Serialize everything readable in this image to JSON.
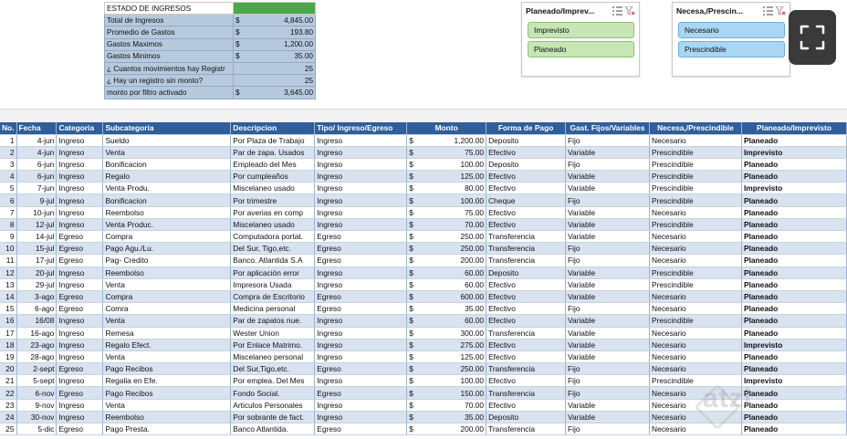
{
  "summary": {
    "title": "ESTADO DE INGRESOS",
    "rows": [
      {
        "label": "Total de Ingresos",
        "currency": "$",
        "value": "4,845.00"
      },
      {
        "label": "Promedio de Gastos",
        "currency": "$",
        "value": "193.80"
      },
      {
        "label": "Gastos Maximos",
        "currency": "$",
        "value": "1,200.00"
      },
      {
        "label": "Gastos Minimos",
        "currency": "$",
        "value": "35.00"
      },
      {
        "label": "¿ Cuantos movimientos hay Registr",
        "currency": "",
        "value": "25"
      },
      {
        "label": "¿ Hay un registro sin monto?",
        "currency": "",
        "value": "25"
      },
      {
        "label": "monto por filtro activado",
        "currency": "$",
        "value": "3,645.00"
      }
    ]
  },
  "slicer1": {
    "title": "Planeado/Imprev...",
    "options": [
      "Imprevisto",
      "Planeado"
    ]
  },
  "slicer2": {
    "title": "Necesa,/Prescin...",
    "options": [
      "Necesario",
      "Prescindible"
    ]
  },
  "table": {
    "headers": [
      "No.",
      "Fecha",
      "Categoria",
      "Subcategoria",
      "Descripcion",
      "Tipo/ Ingreso/Egreso",
      "Monto",
      "Forma de Pago",
      "Gast. Fijos/Variables",
      "Necesa,/Prescindible",
      "Planeado/Imprevisto"
    ],
    "rows": [
      [
        "1",
        "4-jun",
        "Ingreso",
        "Sueldo",
        "Por Plaza de Trabajo",
        "Ingreso",
        "$",
        "1,200.00",
        "Deposito",
        "Fijo",
        "Necesario",
        "Planeado"
      ],
      [
        "2",
        "4-jun",
        "Ingreso",
        "Venta",
        "Par de zapa. Usados",
        "Ingreso",
        "$",
        "75.00",
        "Efectivo",
        "Variable",
        "Prescindible",
        "Imprevisto"
      ],
      [
        "3",
        "6-jun",
        "Ingreso",
        "Bonificacion",
        "Empleado del Mes",
        "Ingreso",
        "$",
        "100.00",
        "Deposito",
        "Fijo",
        "Prescindible",
        "Planeado"
      ],
      [
        "4",
        "6-jun",
        "Ingreso",
        "Regalo",
        "Por cumpleaños",
        "Ingreso",
        "$",
        "125.00",
        "Efectivo",
        "Variable",
        "Prescindible",
        "Planeado"
      ],
      [
        "5",
        "7-jun",
        "Ingreso",
        "Venta Produ.",
        "Miscelaneo usado",
        "Ingreso",
        "$",
        "80.00",
        "Efectivo",
        "Variable",
        "Prescindible",
        "Imprevisto"
      ],
      [
        "6",
        "9-jul",
        "Ingreso",
        "Bonificacion",
        "Por trimestre",
        "Ingreso",
        "$",
        "100.00",
        "Cheque",
        "Fijo",
        "Prescindible",
        "Planeado"
      ],
      [
        "7",
        "10-jun",
        "Ingreso",
        "Reembolso",
        "Por averias en comp",
        "Ingreso",
        "$",
        "75.00",
        "Efectivo",
        "Variable",
        "Necesario",
        "Planeado"
      ],
      [
        "8",
        "12-jul",
        "Ingreso",
        "Venta Produc.",
        "Miscelaneo usado",
        "Ingreso",
        "$",
        "70.00",
        "Efectivo",
        "Variable",
        "Prescindible",
        "Planeado"
      ],
      [
        "9",
        "14-jul",
        "Egreso",
        "Compra",
        "Computadora portat.",
        "Egreso",
        "$",
        "250.00",
        "Transferencia",
        "Variable",
        "Necesario",
        "Planeado"
      ],
      [
        "10",
        "15-jul",
        "Egreso",
        "Pago Agu./Lu.",
        "Del Sur, Tigo,etc.",
        "Egreso",
        "$",
        "250.00",
        "Transferencia",
        "Fijo",
        "Necesario",
        "Planeado"
      ],
      [
        "11",
        "17-jul",
        "Egreso",
        "Pag- Credito",
        "Banco. Atlantida S.A",
        "Egreso",
        "$",
        "200.00",
        "Transferencia",
        "Fijo",
        "Necesario",
        "Planeado"
      ],
      [
        "12",
        "20-jul",
        "Ingreso",
        "Reembolso",
        "Por aplicación error",
        "Ingreso",
        "$",
        "60.00",
        "Deposito",
        "Variable",
        "Prescindible",
        "Planeado"
      ],
      [
        "13",
        "29-jul",
        "Ingreso",
        "Venta",
        "Impresora Usada",
        "Ingreso",
        "$",
        "60.00",
        "Efectivo",
        "Variable",
        "Prescindible",
        "Planeado"
      ],
      [
        "14",
        "3-ago",
        "Egreso",
        "Compra",
        "Compra de Escritorio",
        "Egreso",
        "$",
        "600.00",
        "Efectivo",
        "Variable",
        "Necesario",
        "Planeado"
      ],
      [
        "15",
        "6-ago",
        "Egreso",
        "Comra",
        "Medicina personal",
        "Egreso",
        "$",
        "35.00",
        "Efectivo",
        "Fijo",
        "Necesario",
        "Planeado"
      ],
      [
        "16",
        "16/08",
        "Ingreso",
        "Venta",
        "Par de zapatos nue.",
        "Ingreso",
        "$",
        "60.00",
        "Efectivo",
        "Variable",
        "Prescindible",
        "Planeado"
      ],
      [
        "17",
        "16-ago",
        "Ingreso",
        "Remesa",
        "Wester Union",
        "Ingreso",
        "$",
        "300.00",
        "Transferencia",
        "Variable",
        "Necesario",
        "Planeado"
      ],
      [
        "18",
        "23-ago",
        "Ingreso",
        "Regalo Efect.",
        "Por Enlace Matrimo.",
        "Ingreso",
        "$",
        "275.00",
        "Efectivo",
        "Variable",
        "Necesario",
        "Imprevisto"
      ],
      [
        "19",
        "28-ago",
        "Ingreso",
        "Venta",
        "Miscelaneo personal",
        "Ingreso",
        "$",
        "125.00",
        "Efectivo",
        "Variable",
        "Necesario",
        "Planeado"
      ],
      [
        "20",
        "2-sept",
        "Egreso",
        "Pago Recibos",
        "Del Sur,Tigo,etc.",
        "Egreso",
        "$",
        "250.00",
        "Transferencia",
        "Fijo",
        "Necesario",
        "Planeado"
      ],
      [
        "21",
        "5-sept",
        "Ingreso",
        "Regalia en Efe.",
        "Por emplea. Del Mes",
        "Ingreso",
        "$",
        "100.00",
        "Efectivo",
        "Fijo",
        "Prescindible",
        "Imprevisto"
      ],
      [
        "22",
        "6-nov",
        "Egreso",
        "Pago Recibos",
        "Fondo Social.",
        "Egreso",
        "$",
        "150.00",
        "Transferencia",
        "Fijo",
        "Necesario",
        "Planeado"
      ],
      [
        "23",
        "9-nov",
        "Ingreso",
        "Venta",
        "Articulos Personales",
        "Ingreso",
        "$",
        "70.00",
        "Efectivo",
        "Variable",
        "Necesario",
        "Planeado"
      ],
      [
        "24",
        "30-nov",
        "Ingreso",
        "Reembolso",
        "Por sobrante de fact.",
        "Ingreso",
        "$",
        "35.00",
        "Deposito",
        "Variable",
        "Necesario",
        "Planeado"
      ],
      [
        "25",
        "5-dic",
        "Egreso",
        "Pago Presta.",
        "Banco Atlantida.",
        "Egreso",
        "$",
        "200.00",
        "Transferencia",
        "Fijo",
        "Necesario",
        "Planeado"
      ]
    ]
  },
  "watermark": "atzi",
  "colors": {
    "header": "#2f5f9a",
    "summary": "#b7c9dd",
    "slicer1_btn": "#c6e6b5",
    "slicer2_btn": "#a9d6f2"
  }
}
